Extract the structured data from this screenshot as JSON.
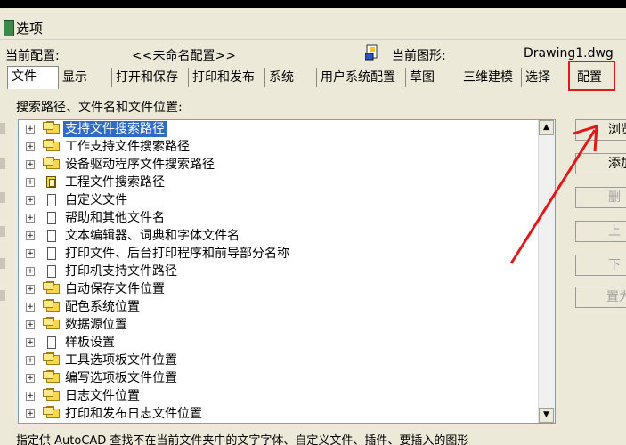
{
  "window": {
    "title": "选项"
  },
  "profile": {
    "current_profile_label": "当前配置:",
    "current_profile_value": "<<未命名配置>>",
    "current_drawing_label": "当前图形:",
    "current_drawing_value": "Drawing1.dwg"
  },
  "tabs": [
    {
      "label": "文件",
      "active": true
    },
    {
      "label": "显示"
    },
    {
      "label": "打开和保存"
    },
    {
      "label": "打印和发布"
    },
    {
      "label": "系统"
    },
    {
      "label": "用户系统配置"
    },
    {
      "label": "草图"
    },
    {
      "label": "三维建模"
    },
    {
      "label": "选择"
    },
    {
      "label": "配置",
      "highlighted": true
    }
  ],
  "panel": {
    "label": "搜索路径、文件名和文件位置:"
  },
  "tree": [
    {
      "label": "支持文件搜索路径",
      "icon": "folder-icon",
      "selected": true
    },
    {
      "label": "工作支持文件搜索路径",
      "icon": "folder-icon"
    },
    {
      "label": "设备驱动程序文件搜索路径",
      "icon": "folder-icon"
    },
    {
      "label": "工程文件搜索路径",
      "icon": "project-icon"
    },
    {
      "label": "自定义文件",
      "icon": "document-icon"
    },
    {
      "label": "帮助和其他文件名",
      "icon": "document-icon"
    },
    {
      "label": "文本编辑器、词典和字体文件名",
      "icon": "document-icon"
    },
    {
      "label": "打印文件、后台打印程序和前导部分名称",
      "icon": "document-icon"
    },
    {
      "label": "打印机支持文件路径",
      "icon": "document-icon"
    },
    {
      "label": "自动保存文件位置",
      "icon": "folder-icon"
    },
    {
      "label": "配色系统位置",
      "icon": "folder-icon"
    },
    {
      "label": "数据源位置",
      "icon": "folder-icon"
    },
    {
      "label": "样板设置",
      "icon": "document-icon"
    },
    {
      "label": "工具选项板文件位置",
      "icon": "folder-icon"
    },
    {
      "label": "编写选项板文件位置",
      "icon": "folder-icon"
    },
    {
      "label": "日志文件位置",
      "icon": "folder-icon"
    },
    {
      "label": "打印和发布日志文件位置",
      "icon": "folder-icon"
    }
  ],
  "buttons": {
    "browse": "浏览",
    "add": "添加",
    "delete": "删",
    "up": "上",
    "down": "下",
    "set_current": "置为"
  },
  "description": "指定供 AutoCAD 查找不在当前文件夹中的文字字体、自定义文件、插件、要插入的图形",
  "colors": {
    "highlight": "#e01818",
    "selection": "#316ac5"
  }
}
